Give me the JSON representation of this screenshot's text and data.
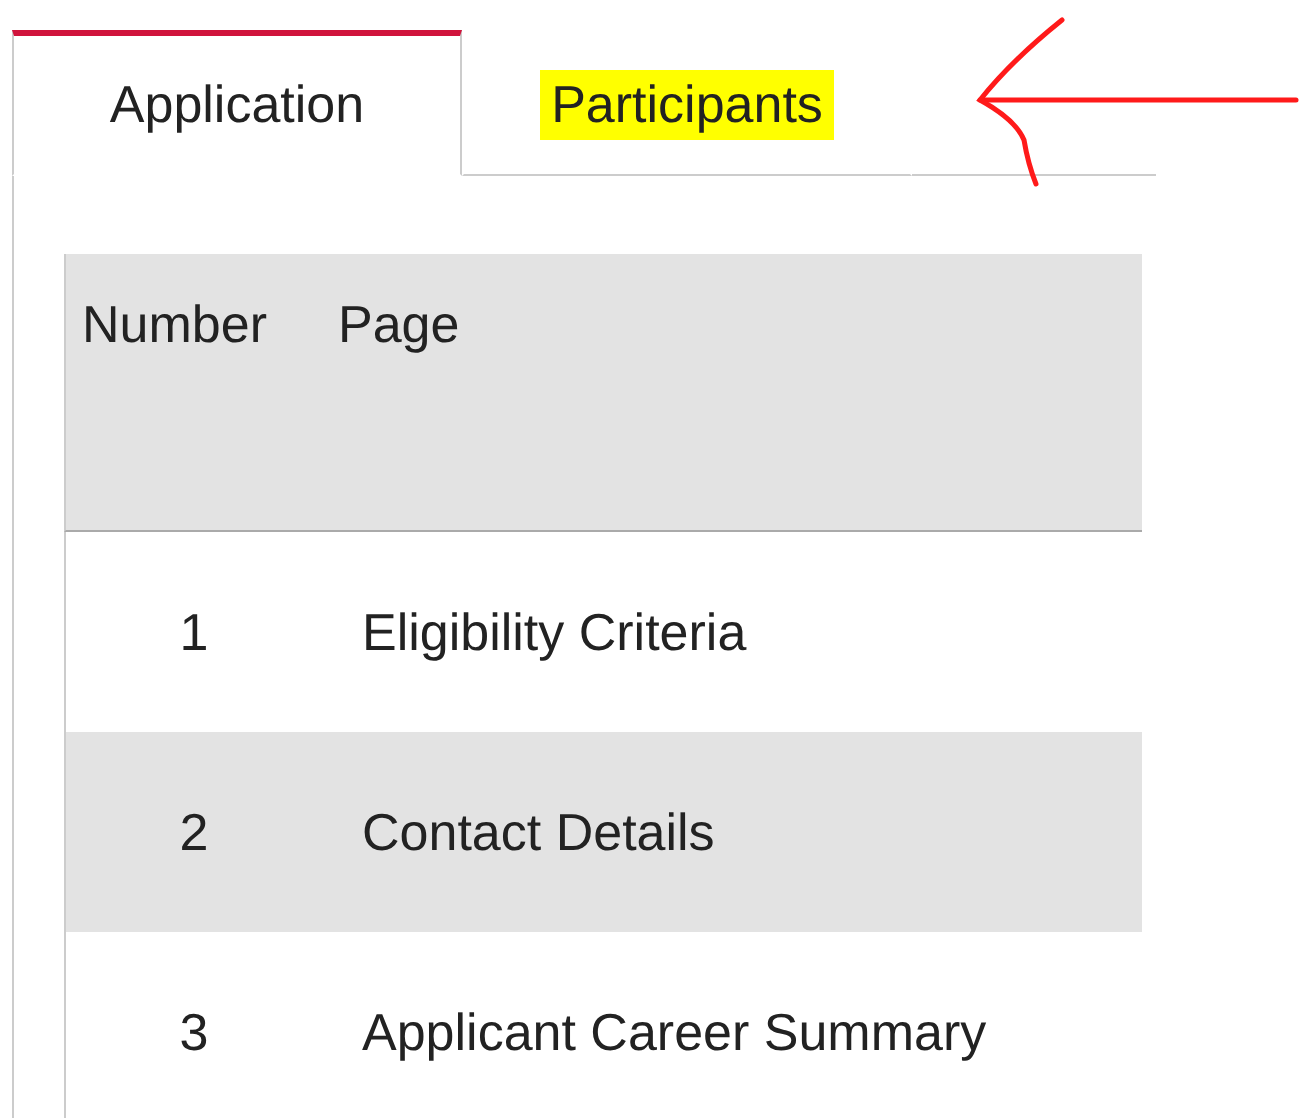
{
  "tabs": [
    {
      "label": "Application",
      "selected": true,
      "highlighted": false
    },
    {
      "label": "Participants",
      "selected": false,
      "highlighted": true
    }
  ],
  "table": {
    "columns": [
      "Number",
      "Page"
    ],
    "rows": [
      {
        "number": "1",
        "page": "Eligibility Criteria"
      },
      {
        "number": "2",
        "page": "Contact Details"
      },
      {
        "number": "3",
        "page": "Applicant Career Summary"
      }
    ]
  }
}
